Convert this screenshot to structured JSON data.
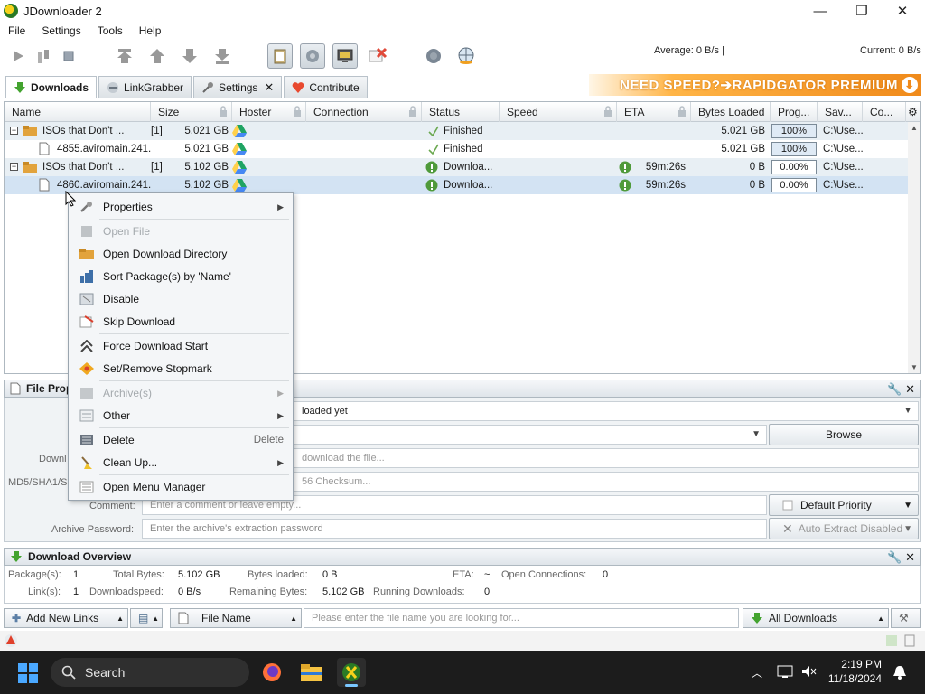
{
  "window": {
    "title": "JDownloader 2",
    "minimize": "—",
    "maximize": "❐",
    "close": "✕"
  },
  "menu": [
    "File",
    "Settings",
    "Tools",
    "Help"
  ],
  "speed": {
    "average": "Average: 0 B/s |",
    "current": "Current: 0 B/s"
  },
  "tabs": {
    "downloads": "Downloads",
    "linkgrabber": "LinkGrabber",
    "settings": "Settings",
    "contribute": "Contribute",
    "settings_close": "✕"
  },
  "banner": {
    "text": "NEED SPEED?➔RAPIDGATOR PREMIUM",
    "icon": "download-arrow-icon"
  },
  "table": {
    "columns": [
      "Name",
      "Size",
      "Hoster",
      "Connection",
      "Status",
      "Speed",
      "ETA",
      "Bytes Loaded",
      "Prog...",
      "Sav...",
      "Co..."
    ],
    "rows": [
      {
        "expander": "−",
        "name": "ISOs that Don't ...",
        "count": "[1]",
        "size": "5.021 GB",
        "status": "Finished",
        "eta": "",
        "bytes": "5.021 GB",
        "progress": "100%",
        "save": "C:\\Use..."
      },
      {
        "expander": "",
        "name": "4855.aviromain.241..",
        "count": "",
        "size": "5.021 GB",
        "status": "Finished",
        "eta": "",
        "bytes": "5.021 GB",
        "progress": "100%",
        "save": "C:\\Use..."
      },
      {
        "expander": "−",
        "name": "ISOs that Don't ...",
        "count": "[1]",
        "size": "5.102 GB",
        "status": "Downloa...",
        "eta": "59m:26s",
        "bytes": "0 B",
        "progress": "0.00%",
        "save": "C:\\Use..."
      },
      {
        "expander": "",
        "name": "4860.aviromain.241..",
        "count": "",
        "size": "5.102 GB",
        "status": "Downloa...",
        "eta": "59m:26s",
        "bytes": "0 B",
        "progress": "0.00%",
        "save": "C:\\Use..."
      }
    ]
  },
  "context_menu": {
    "items": [
      {
        "label": "Properties",
        "icon": "wrench-icon",
        "submenu": "▶",
        "disabled": false
      },
      {
        "label": "Open File",
        "icon": "file-icon",
        "disabled": true
      },
      {
        "label": "Open Download Directory",
        "icon": "folder-icon",
        "disabled": false
      },
      {
        "label": "Sort Package(s) by 'Name'",
        "icon": "sort-icon",
        "disabled": false
      },
      {
        "label": "Disable",
        "icon": "disable-icon",
        "disabled": false
      },
      {
        "label": "Skip Download",
        "icon": "skip-icon",
        "disabled": false
      },
      {
        "label": "Force Download Start",
        "icon": "force-start-icon",
        "disabled": false
      },
      {
        "label": "Set/Remove Stopmark",
        "icon": "stopmark-icon",
        "disabled": false
      },
      {
        "label": "Archive(s)",
        "icon": "archive-icon",
        "submenu": "▶",
        "disabled": true
      },
      {
        "label": "Other",
        "icon": "other-icon",
        "submenu": "▶",
        "disabled": false
      },
      {
        "label": "Delete",
        "icon": "delete-icon",
        "shortcut": "Delete",
        "disabled": false
      },
      {
        "label": "Clean Up...",
        "icon": "broom-icon",
        "submenu": "▶",
        "disabled": false
      },
      {
        "label": "Open Menu Manager",
        "icon": "menu-manager-icon",
        "disabled": false
      }
    ]
  },
  "file_properties": {
    "title": "File Prop",
    "not_loaded_fragment": "loaded yet",
    "download_label_fragment": "Downl",
    "download_placeholder_fragment": "download the file...",
    "checksum_label_fragment": "MD5/SHA1/S",
    "checksum_placeholder_fragment": "56 Checksum...",
    "comment_label": "Comment:",
    "comment_placeholder": "Enter a comment or leave empty...",
    "browse": "Browse",
    "priority": "Default Priority",
    "archive_password_label": "Archive Password:",
    "archive_password_placeholder": "Enter the archive's extraction password",
    "auto_extract": "Auto Extract Disabled",
    "controls": "🔧 ✕"
  },
  "overview": {
    "title": "Download Overview",
    "controls": "🔧 ✕",
    "packages_label": "Package(s):",
    "packages": "1",
    "total_bytes_label": "Total Bytes:",
    "total_bytes": "5.102 GB",
    "bytes_loaded_label": "Bytes loaded:",
    "bytes_loaded": "0 B",
    "eta_label": "ETA:",
    "eta": "~",
    "open_connections_label": "Open Connections:",
    "open_connections": "0",
    "links_label": "Link(s):",
    "links": "1",
    "download_speed_label": "Downloadspeed:",
    "download_speed": "0 B/s",
    "remaining_label": "Remaining Bytes:",
    "remaining": "5.102 GB",
    "running_label": "Running Downloads:",
    "running": "0"
  },
  "bottombar": {
    "add_links": "Add New Links",
    "file_name": "File Name",
    "search_placeholder": "Please enter the file name you are looking for...",
    "all_downloads": "All Downloads"
  },
  "taskbar": {
    "search": "Search",
    "time": "2:19 PM",
    "date": "11/18/2024"
  }
}
